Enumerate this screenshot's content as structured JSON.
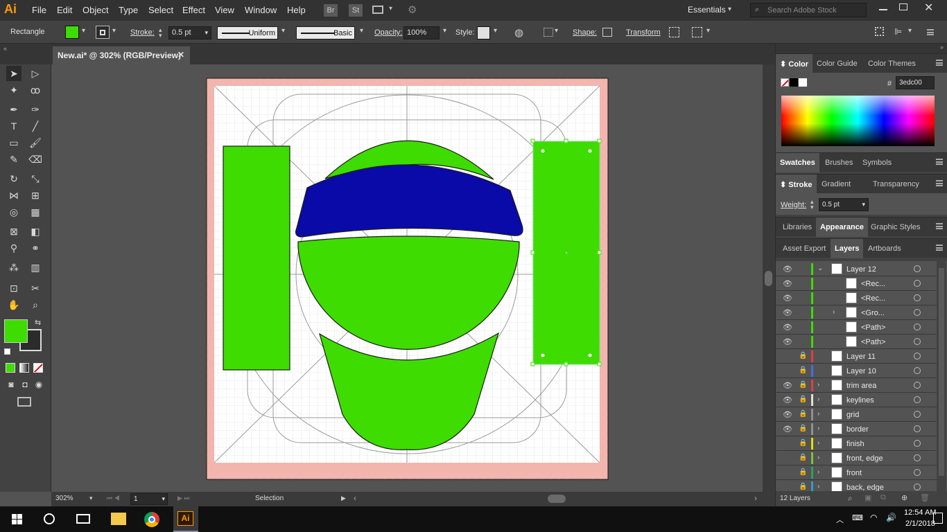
{
  "app": {
    "logo": "Ai"
  },
  "menu": [
    "File",
    "Edit",
    "Object",
    "Type",
    "Select",
    "Effect",
    "View",
    "Window",
    "Help"
  ],
  "bridge": [
    "Br",
    "St"
  ],
  "workspace": "Essentials",
  "search_placeholder": "Search Adobe Stock",
  "control": {
    "tool_name": "Rectangle",
    "stroke_label": "Stroke:",
    "stroke_value": "0.5 pt",
    "profile_uniform": "Uniform",
    "profile_basic": "Basic",
    "opacity_label": "Opacity:",
    "opacity_value": "100%",
    "style_label": "Style:",
    "shape_label": "Shape:",
    "transform_label": "Transform",
    "fill_color": "#3edc00"
  },
  "document": {
    "tab_title": "New.ai* @ 302% (RGB/Preview)"
  },
  "status": {
    "zoom": "302%",
    "artboard": "1",
    "tool": "Selection"
  },
  "panels": {
    "color_tabs": [
      "Color",
      "Color Guide",
      "Color Themes"
    ],
    "hex_label": "#",
    "hex_value": "3edc00",
    "swatch_tabs": [
      "Swatches",
      "Brushes",
      "Symbols"
    ],
    "stroke_tabs": [
      "Stroke",
      "Gradient",
      "Transparency"
    ],
    "weight_label": "Weight:",
    "weight_value": "0.5 pt",
    "appearance_tabs": [
      "Libraries",
      "Appearance",
      "Graphic Styles"
    ],
    "layers_tabs": [
      "Asset Export",
      "Layers",
      "Artboards"
    ],
    "layers": [
      {
        "name": "Layer 12",
        "color": "#3edc00",
        "eye": true,
        "lock": false,
        "expand": "open"
      },
      {
        "name": "<Rec...",
        "color": "#3edc00",
        "eye": true,
        "lock": false,
        "expand": "",
        "child": true
      },
      {
        "name": "<Rec...",
        "color": "#3edc00",
        "eye": true,
        "lock": false,
        "expand": "",
        "child": true
      },
      {
        "name": "<Gro...",
        "color": "#3edc00",
        "eye": true,
        "lock": false,
        "expand": "closed",
        "child": true
      },
      {
        "name": "<Path>",
        "color": "#3edc00",
        "eye": true,
        "lock": false,
        "expand": "",
        "child": true
      },
      {
        "name": "<Path>",
        "color": "#3edc00",
        "eye": true,
        "lock": false,
        "expand": "",
        "child": true
      },
      {
        "name": "Layer 11",
        "color": "#e04040",
        "eye": false,
        "lock": true,
        "expand": ""
      },
      {
        "name": "Layer 10",
        "color": "#4070e0",
        "eye": false,
        "lock": true,
        "expand": ""
      },
      {
        "name": "trim area",
        "color": "#e04040",
        "eye": true,
        "lock": true,
        "expand": "closed"
      },
      {
        "name": "keylines",
        "color": "#e0e0e0",
        "eye": true,
        "lock": true,
        "expand": "closed"
      },
      {
        "name": "grid",
        "color": "#909090",
        "eye": true,
        "lock": true,
        "expand": "closed"
      },
      {
        "name": "border",
        "color": "#909090",
        "eye": true,
        "lock": true,
        "expand": "closed"
      },
      {
        "name": "finish",
        "color": "#e0e000",
        "eye": false,
        "lock": true,
        "expand": "closed"
      },
      {
        "name": "front, edge",
        "color": "#80c040",
        "eye": false,
        "lock": true,
        "expand": "closed"
      },
      {
        "name": "front",
        "color": "#30a060",
        "eye": false,
        "lock": true,
        "expand": "closed"
      },
      {
        "name": "back, edge",
        "color": "#30a0c0",
        "eye": false,
        "lock": true,
        "expand": "closed"
      }
    ],
    "layers_count": "12 Layers"
  },
  "taskbar": {
    "time": "12:54 AM",
    "date": "2/1/2018"
  }
}
